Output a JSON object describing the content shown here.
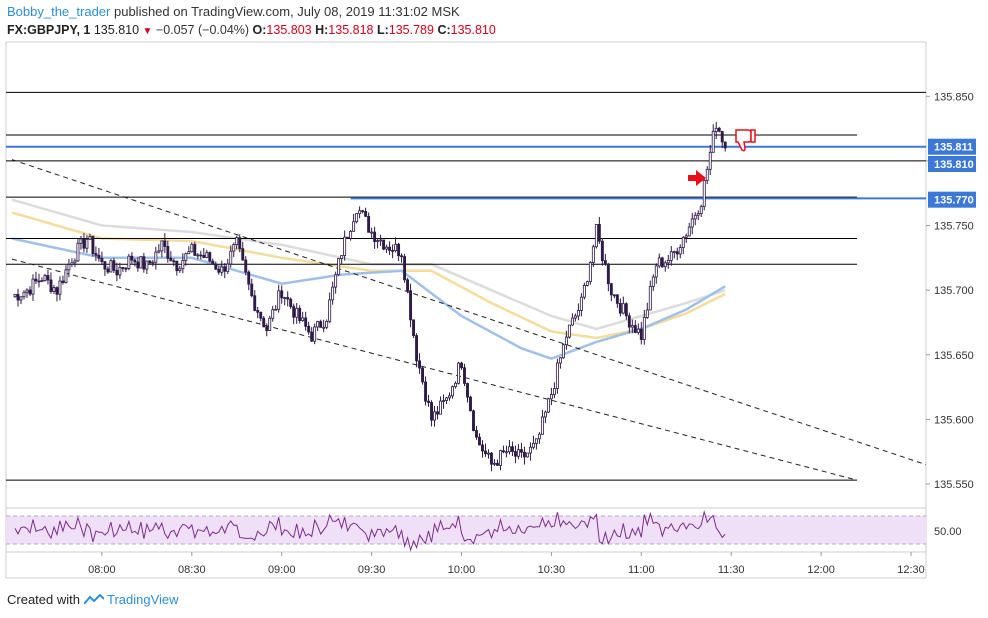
{
  "header": {
    "author": "Bobby_the_trader",
    "published": "published on TradingView.com, July 08, 2019 11:31:02 MSK",
    "symbol": "FX:GBPJPY, 1",
    "last": "135.810",
    "change": "−0.057 (−0.04%)",
    "o_label": "O:",
    "o_value": "135.803",
    "h_label": "H:",
    "h_value": "135.818",
    "l_label": "L:",
    "l_value": "135.789",
    "c_label": "C:",
    "c_value": "135.810"
  },
  "footer": {
    "created": "Created with",
    "brand": "TradingView"
  },
  "colors": {
    "candle_up": "#ffffff",
    "candle_down": "#2e1a47",
    "wick": "#2e1a47",
    "ma_fast": "#9fc0e8",
    "ma_mid": "#f4dc9a",
    "ma_slow": "#dcdcdc",
    "hline_blue": "#3c78d8",
    "hline_black": "#000000",
    "rsi_line": "#7b2d8b",
    "rsi_band": "#efe0f7",
    "arrow": "#e8101b"
  },
  "chart_data": {
    "type": "candlestick",
    "x_label_ticks": [
      "08:00",
      "08:30",
      "09:00",
      "09:30",
      "10:00",
      "10:30",
      "11:00",
      "11:30",
      "12:00",
      "12:30"
    ],
    "x_range_minutes_from_0730": [
      0,
      305
    ],
    "y_ticks": [
      "135.850",
      "135.800",
      "135.750",
      "135.700",
      "135.650",
      "135.600",
      "135.550"
    ],
    "ylim": [
      135.533,
      135.892
    ],
    "price_tags": [
      {
        "label": "135.811",
        "value": 135.811,
        "color": "#3c78d8"
      },
      {
        "label": "135.810",
        "value": 135.81,
        "color": "#3c78d8"
      },
      {
        "label": "135.770",
        "value": 135.77,
        "color": "#3c78d8"
      }
    ],
    "horizontal_levels": [
      {
        "value": 135.853,
        "color": "#000000",
        "x_from_min": 0,
        "x_to_min": 305
      },
      {
        "value": 135.82,
        "color": "#000000",
        "x_from_min": 0,
        "x_to_min": 282
      },
      {
        "value": 135.811,
        "color": "#3c78d8",
        "x_from_min": 0,
        "x_to_min": 305
      },
      {
        "value": 135.8,
        "color": "#000000",
        "x_from_min": 0,
        "x_to_min": 305
      },
      {
        "value": 135.772,
        "color": "#000000",
        "x_from_min": 0,
        "x_to_min": 282
      },
      {
        "value": 135.771,
        "color": "#3c78d8",
        "x_from_min": 113,
        "x_to_min": 305
      },
      {
        "value": 135.74,
        "color": "#000000",
        "x_from_min": 0,
        "x_to_min": 282
      },
      {
        "value": 135.72,
        "color": "#000000",
        "x_from_min": 0,
        "x_to_min": 282
      },
      {
        "value": 135.553,
        "color": "#000000",
        "x_from_min": 0,
        "x_to_min": 282
      }
    ],
    "trendlines": [
      {
        "from": [
          0,
          135.801
        ],
        "to": [
          305,
          135.565
        ]
      },
      {
        "from": [
          0,
          135.724
        ],
        "to": [
          282,
          135.553
        ]
      }
    ],
    "candles_anchor": [
      [
        0,
        135.695
      ],
      [
        5,
        135.7
      ],
      [
        10,
        135.71
      ],
      [
        15,
        135.7
      ],
      [
        20,
        135.725
      ],
      [
        25,
        135.74
      ],
      [
        30,
        135.72
      ],
      [
        35,
        135.715
      ],
      [
        40,
        135.725
      ],
      [
        45,
        135.718
      ],
      [
        50,
        135.735
      ],
      [
        55,
        135.72
      ],
      [
        60,
        135.73
      ],
      [
        65,
        135.725
      ],
      [
        70,
        135.715
      ],
      [
        75,
        135.735
      ],
      [
        80,
        135.695
      ],
      [
        85,
        135.67
      ],
      [
        90,
        135.7
      ],
      [
        95,
        135.68
      ],
      [
        100,
        135.665
      ],
      [
        105,
        135.68
      ],
      [
        110,
        135.73
      ],
      [
        115,
        135.765
      ],
      [
        120,
        135.745
      ],
      [
        125,
        135.735
      ],
      [
        130,
        135.73
      ],
      [
        135,
        135.65
      ],
      [
        140,
        135.6
      ],
      [
        145,
        135.615
      ],
      [
        150,
        135.645
      ],
      [
        155,
        135.585
      ],
      [
        160,
        135.565
      ],
      [
        165,
        135.575
      ],
      [
        170,
        135.57
      ],
      [
        175,
        135.58
      ],
      [
        180,
        135.62
      ],
      [
        185,
        135.665
      ],
      [
        190,
        135.69
      ],
      [
        195,
        135.745
      ],
      [
        200,
        135.7
      ],
      [
        205,
        135.68
      ],
      [
        210,
        135.665
      ],
      [
        215,
        135.72
      ],
      [
        220,
        135.725
      ],
      [
        225,
        135.745
      ],
      [
        230,
        135.77
      ],
      [
        235,
        135.83
      ],
      [
        238,
        135.812
      ]
    ],
    "ma_series": [
      {
        "color": "#dcdcdc",
        "points": [
          [
            0,
            135.77
          ],
          [
            30,
            135.75
          ],
          [
            60,
            135.745
          ],
          [
            90,
            135.735
          ],
          [
            120,
            135.72
          ],
          [
            140,
            135.72
          ],
          [
            160,
            135.7
          ],
          [
            180,
            135.68
          ],
          [
            195,
            135.67
          ],
          [
            210,
            135.68
          ],
          [
            225,
            135.69
          ],
          [
            238,
            135.7
          ]
        ]
      },
      {
        "color": "#f4dc9a",
        "points": [
          [
            0,
            135.76
          ],
          [
            30,
            135.74
          ],
          [
            60,
            135.738
          ],
          [
            90,
            135.725
          ],
          [
            120,
            135.715
          ],
          [
            140,
            135.715
          ],
          [
            160,
            135.69
          ],
          [
            180,
            135.668
          ],
          [
            195,
            135.663
          ],
          [
            210,
            135.67
          ],
          [
            225,
            135.682
          ],
          [
            238,
            135.697
          ]
        ]
      },
      {
        "color": "#9fc0e8",
        "points": [
          [
            0,
            135.74
          ],
          [
            30,
            135.725
          ],
          [
            60,
            135.725
          ],
          [
            90,
            135.705
          ],
          [
            110,
            135.712
          ],
          [
            130,
            135.715
          ],
          [
            150,
            135.68
          ],
          [
            170,
            135.655
          ],
          [
            180,
            135.647
          ],
          [
            195,
            135.66
          ],
          [
            210,
            135.67
          ],
          [
            225,
            135.685
          ],
          [
            238,
            135.703
          ]
        ]
      }
    ],
    "rsi": {
      "ylabel_tick": "50.00",
      "value_mid": 50
    }
  }
}
